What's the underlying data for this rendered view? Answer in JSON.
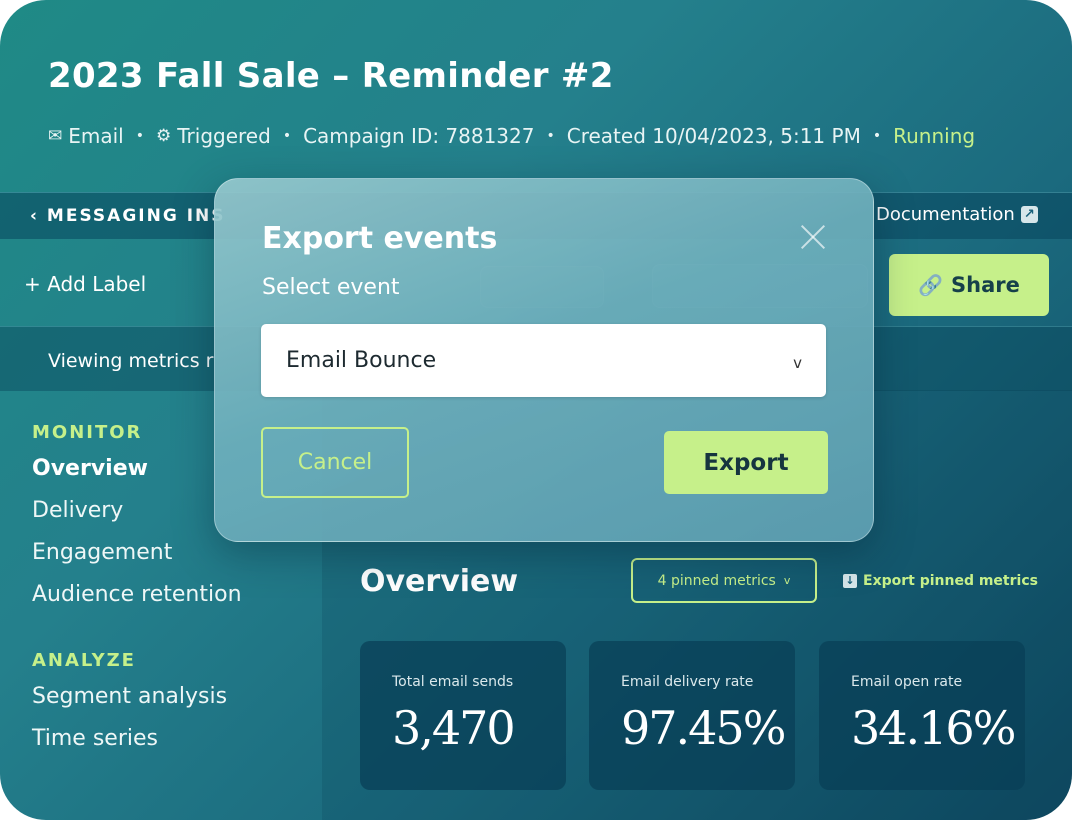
{
  "campaign": {
    "title": "2023 Fall Sale – Reminder #2",
    "channel": "Email",
    "channel_icon": "envelope-icon",
    "trigger": "Triggered",
    "trigger_icon": "gear-icon",
    "campaign_id": "Campaign ID: 7881327",
    "created": "Created 10/04/2023, 5:11 PM",
    "status": "Running",
    "status_color": "#c6f08a"
  },
  "subnav": {
    "back_label": "‹ MESSAGING INS",
    "docs_label": "Documentation"
  },
  "toolbar": {
    "add_label": "+ Add Label",
    "share_label": "Share"
  },
  "viewing": {
    "text": "Viewing metrics r"
  },
  "sidebar": {
    "monitor_heading": "MONITOR",
    "monitor_items": [
      {
        "label": "Overview",
        "active": true
      },
      {
        "label": "Delivery"
      },
      {
        "label": "Engagement"
      },
      {
        "label": "Audience retention"
      }
    ],
    "analyze_heading": "ANALYZE",
    "analyze_items": [
      {
        "label": "Segment analysis"
      },
      {
        "label": "Time series"
      }
    ]
  },
  "overview": {
    "heading": "Overview",
    "pinned_label": "4 pinned metrics",
    "export_pinned_label": "Export pinned metrics",
    "metrics": [
      {
        "label": "Total email sends",
        "value": "3,470"
      },
      {
        "label": "Email delivery rate",
        "value": "97.45%"
      },
      {
        "label": "Email open rate",
        "value": "34.16%"
      }
    ]
  },
  "modal": {
    "title": "Export events",
    "select_label": "Select event",
    "selected_value": "Email Bounce",
    "cancel_label": "Cancel",
    "export_label": "Export"
  },
  "colors": {
    "accent": "#c6f08a",
    "background_dark": "#0f4a62",
    "background_light": "#1f8a86"
  }
}
